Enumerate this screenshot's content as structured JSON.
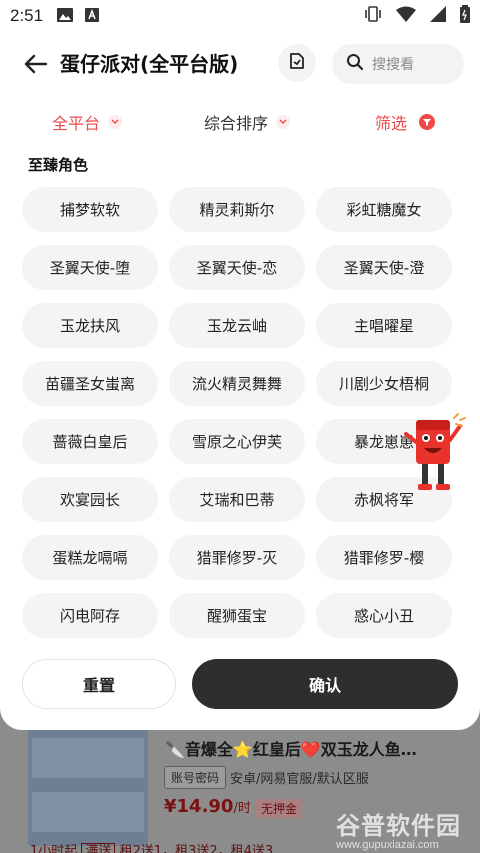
{
  "status_bar": {
    "time": "2:51"
  },
  "header": {
    "title": "蛋仔派对(全平台版)",
    "search_placeholder": "搜搜看"
  },
  "tabs": {
    "platform": "全平台",
    "sort": "综合排序",
    "filter": "筛选"
  },
  "section": {
    "title": "至臻角色"
  },
  "characters": [
    "捕梦软软",
    "精灵莉斯尔",
    "彩虹糖魔女",
    "圣翼天使-堕",
    "圣翼天使-恋",
    "圣翼天使-澄",
    "玉龙扶风",
    "玉龙云岫",
    "主唱曜星",
    "苗疆圣女蚩离",
    "流火精灵舞舞",
    "川剧少女梧桐",
    "蔷薇白皇后",
    "雪原之心伊芙",
    "暴龙崽崽",
    "欢宴园长",
    "艾瑞和巴蒂",
    "赤枫将军",
    "蛋糕龙嗝嗝",
    "猎罪修罗-灭",
    "猎罪修罗-樱",
    "闪电阿存",
    "醒狮蛋宝",
    "惑心小丑"
  ],
  "actions": {
    "reset": "重置",
    "confirm": "确认"
  },
  "listing": {
    "title": "🔪音爆全⭐红皇后❤️双玉龙人鱼…",
    "tag": "账号密码",
    "meta": "安卓/网易官服/默认区服",
    "price": "¥14.90",
    "price_unit": "/时",
    "deposit": "无押金",
    "bottom_start": "1小时起",
    "bottom_badge": "满送",
    "bottom_promo": "租2送1，租3送2，租4送3"
  },
  "watermark": {
    "text": "谷普软件园",
    "url": "www.gupuxiazai.com"
  },
  "colors": {
    "accent_red": "#ee4a4a",
    "chip_bg": "#f4f4f4",
    "confirm_bg": "#2e2e2e"
  },
  "icons": {
    "back": "arrow-left-icon",
    "doc": "document-icon",
    "search": "search-icon",
    "caret": "chevron-down-icon",
    "filter": "funnel-icon"
  }
}
